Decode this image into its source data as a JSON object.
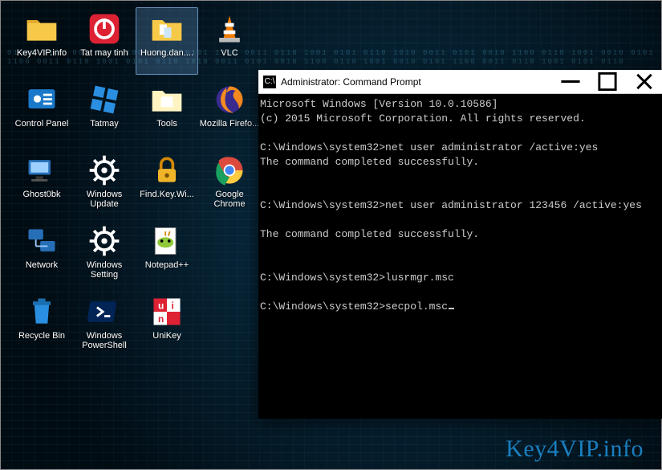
{
  "watermark": "Key4VIP.info",
  "desktopIcons": [
    {
      "name": "key4vip-folder",
      "label": "Key4VIP.info",
      "icon": "folder"
    },
    {
      "name": "tat-may-tinh",
      "label": "Tat may tinh",
      "icon": "power"
    },
    {
      "name": "huong-dan-folder",
      "label": "Huong.dan....",
      "icon": "folder-docs",
      "selected": true
    },
    {
      "name": "vlc",
      "label": "VLC",
      "icon": "vlc"
    },
    {
      "name": "control-panel",
      "label": "Control Panel",
      "icon": "controlpanel"
    },
    {
      "name": "tatmay",
      "label": "Tatmay",
      "icon": "winapp"
    },
    {
      "name": "tools-folder",
      "label": "Tools",
      "icon": "folder-light"
    },
    {
      "name": "firefox",
      "label": "Mozilla Firefo...",
      "icon": "firefox"
    },
    {
      "name": "ghost0bk",
      "label": "Ghost0bk",
      "icon": "computer"
    },
    {
      "name": "windows-update",
      "label": "Windows Update",
      "icon": "gear"
    },
    {
      "name": "find-key-wi",
      "label": "Find.Key.Wi...",
      "icon": "lock"
    },
    {
      "name": "chrome",
      "label": "Google Chrome",
      "icon": "chrome"
    },
    {
      "name": "network",
      "label": "Network",
      "icon": "network"
    },
    {
      "name": "windows-setting",
      "label": "Windows Setting",
      "icon": "gear"
    },
    {
      "name": "notepadpp",
      "label": "Notepad++",
      "icon": "notepadpp"
    },
    {
      "name": "_empty15",
      "label": "",
      "icon": "empty"
    },
    {
      "name": "recycle-bin",
      "label": "Recycle Bin",
      "icon": "recycle"
    },
    {
      "name": "powershell",
      "label": "Windows PowerShell",
      "icon": "powershell"
    },
    {
      "name": "unikey",
      "label": "UniKey",
      "icon": "unikey"
    }
  ],
  "cmd": {
    "title": "Administrator: Command Prompt",
    "lines": [
      "Microsoft Windows [Version 10.0.10586]",
      "(c) 2015 Microsoft Corporation. All rights reserved.",
      "",
      "C:\\Windows\\system32>net user administrator /active:yes",
      "The command completed successfully.",
      "",
      "",
      "C:\\Windows\\system32>net user administrator 123456 /active:yes",
      "",
      "The command completed successfully.",
      "",
      "",
      "C:\\Windows\\system32>lusrmgr.msc",
      "",
      "C:\\Windows\\system32>secpol.msc"
    ]
  }
}
